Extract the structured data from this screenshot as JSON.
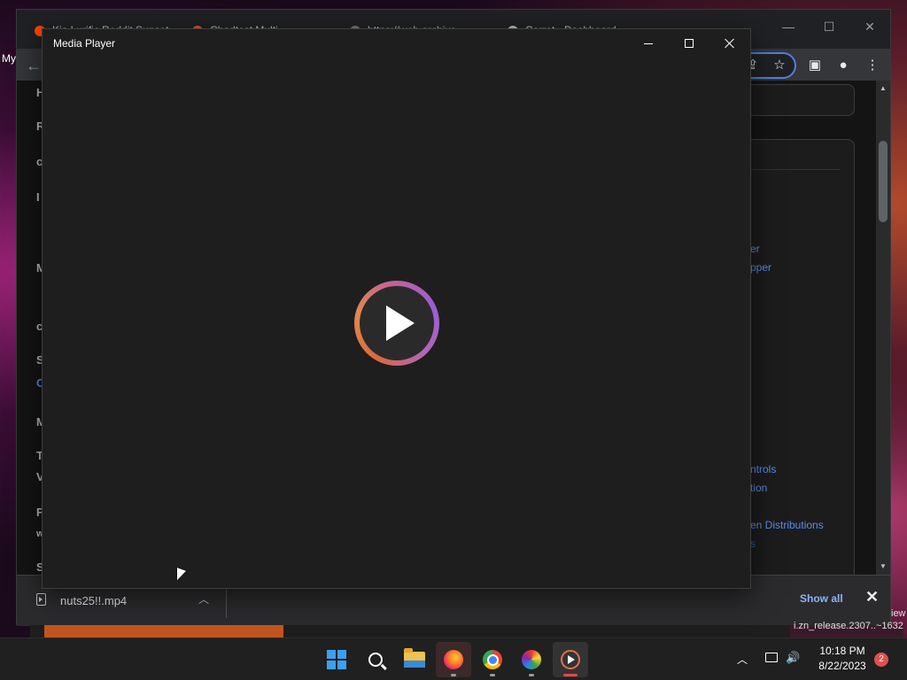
{
  "desktop": {
    "edge_label": "My"
  },
  "browser": {
    "tabs": [
      {
        "label": "Kia Lurific Reddit Sunset"
      },
      {
        "label": "Chadtest Multi..."
      },
      {
        "label": "https://web.archive..."
      },
      {
        "label": "Carrot - Dashboard..."
      }
    ],
    "page": {
      "left_letters": [
        "H",
        "R",
        "c",
        "I",
        "M",
        "c",
        "S",
        "C",
        "M",
        "T",
        "V",
        "F",
        "w",
        "S"
      ],
      "links": [
        "er",
        "pper",
        "ntrols",
        "tion",
        "en Distributions",
        "s"
      ]
    },
    "download_bar": {
      "filename": "nuts25!!.mp4",
      "show_all": "Show all"
    }
  },
  "background_window": {
    "corner_text": "i.zn_release.2307..~1632",
    "edge_text": "iew"
  },
  "media_player": {
    "title": "Media Player"
  },
  "taskbar": {
    "time": "10:18 PM",
    "date": "8/22/2023",
    "notification_count": "2"
  }
}
